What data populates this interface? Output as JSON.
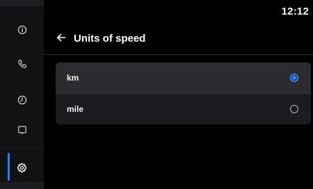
{
  "status_bar": {
    "time": "12:12"
  },
  "sidebar": {
    "items": [
      {
        "name": "info",
        "icon": "info-circle-icon",
        "active": false
      },
      {
        "name": "phone",
        "icon": "phone-icon",
        "active": false
      },
      {
        "name": "clock",
        "icon": "clock-icon",
        "active": false
      },
      {
        "name": "screen-mirror",
        "icon": "screen-mirror-icon",
        "active": false
      },
      {
        "name": "settings",
        "icon": "gear-icon",
        "active": true
      }
    ]
  },
  "header": {
    "back_icon": "arrow-left-icon",
    "title": "Units of speed"
  },
  "options": [
    {
      "label": "km",
      "selected": true
    },
    {
      "label": "mile",
      "selected": false
    }
  ],
  "colors": {
    "accent": "#3b82f6",
    "background": "#000000",
    "sidebar": "#111214",
    "panel": "#1b1c1f",
    "selected_row": "#2b2c30"
  }
}
